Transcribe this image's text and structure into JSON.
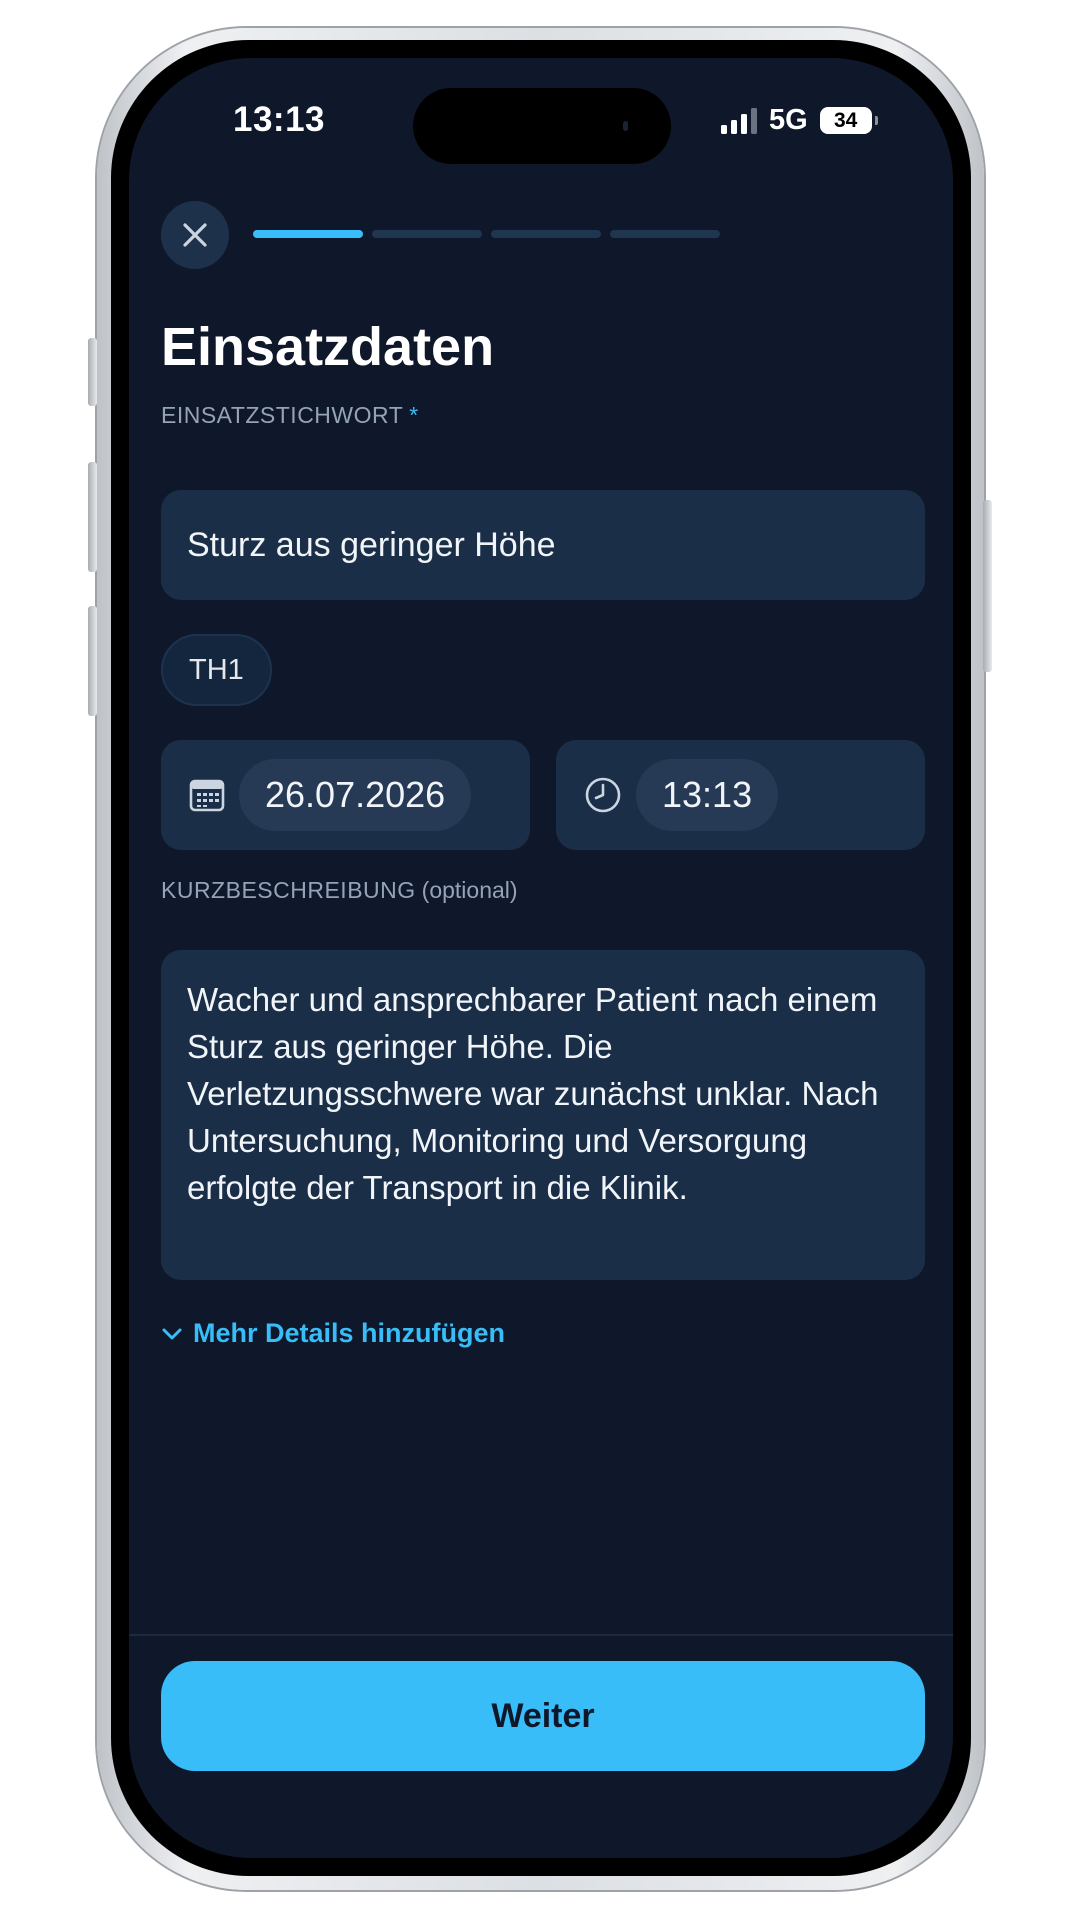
{
  "status_bar": {
    "time": "13:13",
    "network": "5G",
    "battery": "34"
  },
  "progress": {
    "current_step": 1,
    "total_steps": 4
  },
  "page": {
    "title": "Einsatzdaten"
  },
  "keyword": {
    "label": "EINSATZSTICHWORT",
    "required_marker": "*",
    "value": "Sturz aus geringer Höhe",
    "code_chip": "TH1"
  },
  "datetime": {
    "date": "26.07.2026",
    "time": "13:13"
  },
  "description": {
    "label": "KURZBESCHREIBUNG",
    "optional_marker": "(optional)",
    "value": "Wacher und ansprechbarer Patient nach einem Sturz aus geringer Höhe. Die Verletzungsschwere war zunächst unklar. Nach Untersuchung, Monitoring und Versorgung erfolgte der Transport in die Klinik."
  },
  "more_details": {
    "label": "Mehr Details hinzufügen"
  },
  "footer": {
    "continue_label": "Weiter"
  },
  "icons": {
    "close": "close-icon",
    "calendar": "calendar-icon",
    "clock": "clock-icon",
    "chevron": "chevron-down-icon"
  },
  "colors": {
    "background": "#0f172a",
    "accent": "#38bdf8",
    "field": "#1a2e47"
  }
}
